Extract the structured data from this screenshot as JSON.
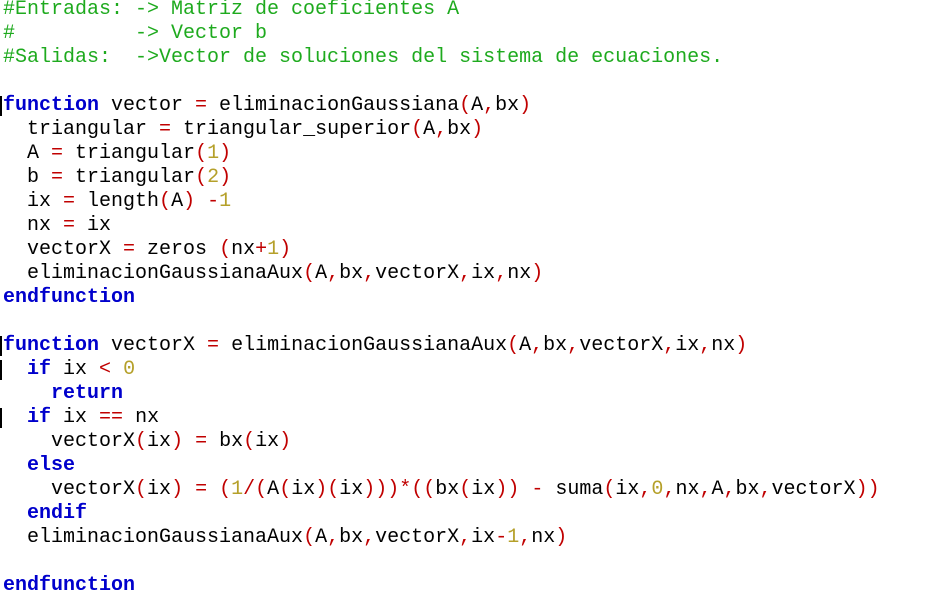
{
  "editor": {
    "language": "Octave",
    "colors": {
      "comment": "#1eaa1e",
      "keyword": "#0000cc",
      "identifier": "#000000",
      "number": "#b5a02a",
      "operator": "#c00000"
    },
    "lines": [
      [
        {
          "t": "comment",
          "s": "#Entradas: -> Matriz de coeficientes A"
        }
      ],
      [
        {
          "t": "comment",
          "s": "#          -> Vector b"
        }
      ],
      [
        {
          "t": "comment",
          "s": "#Salidas:  ->Vector de soluciones del sistema de ecuaciones."
        }
      ],
      [],
      [
        {
          "t": "kw",
          "s": "function"
        },
        {
          "t": "id",
          "s": " vector "
        },
        {
          "t": "op",
          "s": "="
        },
        {
          "t": "id",
          "s": " eliminacionGaussiana"
        },
        {
          "t": "op",
          "s": "("
        },
        {
          "t": "id",
          "s": "A"
        },
        {
          "t": "op",
          "s": ","
        },
        {
          "t": "id",
          "s": "bx"
        },
        {
          "t": "op",
          "s": ")"
        }
      ],
      [
        {
          "t": "id",
          "s": "  triangular "
        },
        {
          "t": "op",
          "s": "="
        },
        {
          "t": "id",
          "s": " triangular_superior"
        },
        {
          "t": "op",
          "s": "("
        },
        {
          "t": "id",
          "s": "A"
        },
        {
          "t": "op",
          "s": ","
        },
        {
          "t": "id",
          "s": "bx"
        },
        {
          "t": "op",
          "s": ")"
        }
      ],
      [
        {
          "t": "id",
          "s": "  A "
        },
        {
          "t": "op",
          "s": "="
        },
        {
          "t": "id",
          "s": " triangular"
        },
        {
          "t": "op",
          "s": "("
        },
        {
          "t": "num",
          "s": "1"
        },
        {
          "t": "op",
          "s": ")"
        }
      ],
      [
        {
          "t": "id",
          "s": "  b "
        },
        {
          "t": "op",
          "s": "="
        },
        {
          "t": "id",
          "s": " triangular"
        },
        {
          "t": "op",
          "s": "("
        },
        {
          "t": "num",
          "s": "2"
        },
        {
          "t": "op",
          "s": ")"
        }
      ],
      [
        {
          "t": "id",
          "s": "  ix "
        },
        {
          "t": "op",
          "s": "="
        },
        {
          "t": "id",
          "s": " length"
        },
        {
          "t": "op",
          "s": "("
        },
        {
          "t": "id",
          "s": "A"
        },
        {
          "t": "op",
          "s": ")"
        },
        {
          "t": "id",
          "s": " "
        },
        {
          "t": "op",
          "s": "-"
        },
        {
          "t": "num",
          "s": "1"
        }
      ],
      [
        {
          "t": "id",
          "s": "  nx "
        },
        {
          "t": "op",
          "s": "="
        },
        {
          "t": "id",
          "s": " ix"
        }
      ],
      [
        {
          "t": "id",
          "s": "  vectorX "
        },
        {
          "t": "op",
          "s": "="
        },
        {
          "t": "id",
          "s": " zeros "
        },
        {
          "t": "op",
          "s": "("
        },
        {
          "t": "id",
          "s": "nx"
        },
        {
          "t": "op",
          "s": "+"
        },
        {
          "t": "num",
          "s": "1"
        },
        {
          "t": "op",
          "s": ")"
        }
      ],
      [
        {
          "t": "id",
          "s": "  eliminacionGaussianaAux"
        },
        {
          "t": "op",
          "s": "("
        },
        {
          "t": "id",
          "s": "A"
        },
        {
          "t": "op",
          "s": ","
        },
        {
          "t": "id",
          "s": "bx"
        },
        {
          "t": "op",
          "s": ","
        },
        {
          "t": "id",
          "s": "vectorX"
        },
        {
          "t": "op",
          "s": ","
        },
        {
          "t": "id",
          "s": "ix"
        },
        {
          "t": "op",
          "s": ","
        },
        {
          "t": "id",
          "s": "nx"
        },
        {
          "t": "op",
          "s": ")"
        }
      ],
      [
        {
          "t": "kw",
          "s": "endfunction"
        }
      ],
      [],
      [
        {
          "t": "kw",
          "s": "function"
        },
        {
          "t": "id",
          "s": " vectorX "
        },
        {
          "t": "op",
          "s": "="
        },
        {
          "t": "id",
          "s": " eliminacionGaussianaAux"
        },
        {
          "t": "op",
          "s": "("
        },
        {
          "t": "id",
          "s": "A"
        },
        {
          "t": "op",
          "s": ","
        },
        {
          "t": "id",
          "s": "bx"
        },
        {
          "t": "op",
          "s": ","
        },
        {
          "t": "id",
          "s": "vectorX"
        },
        {
          "t": "op",
          "s": ","
        },
        {
          "t": "id",
          "s": "ix"
        },
        {
          "t": "op",
          "s": ","
        },
        {
          "t": "id",
          "s": "nx"
        },
        {
          "t": "op",
          "s": ")"
        }
      ],
      [
        {
          "t": "id",
          "s": "  "
        },
        {
          "t": "kw",
          "s": "if"
        },
        {
          "t": "id",
          "s": " ix "
        },
        {
          "t": "op",
          "s": "<"
        },
        {
          "t": "id",
          "s": " "
        },
        {
          "t": "num",
          "s": "0"
        }
      ],
      [
        {
          "t": "id",
          "s": "    "
        },
        {
          "t": "kw",
          "s": "return"
        }
      ],
      [
        {
          "t": "id",
          "s": "  "
        },
        {
          "t": "kw",
          "s": "if"
        },
        {
          "t": "id",
          "s": " ix "
        },
        {
          "t": "op",
          "s": "=="
        },
        {
          "t": "id",
          "s": " nx"
        }
      ],
      [
        {
          "t": "id",
          "s": "    vectorX"
        },
        {
          "t": "op",
          "s": "("
        },
        {
          "t": "id",
          "s": "ix"
        },
        {
          "t": "op",
          "s": ")"
        },
        {
          "t": "id",
          "s": " "
        },
        {
          "t": "op",
          "s": "="
        },
        {
          "t": "id",
          "s": " bx"
        },
        {
          "t": "op",
          "s": "("
        },
        {
          "t": "id",
          "s": "ix"
        },
        {
          "t": "op",
          "s": ")"
        }
      ],
      [
        {
          "t": "id",
          "s": "  "
        },
        {
          "t": "kw",
          "s": "else"
        }
      ],
      [
        {
          "t": "id",
          "s": "    vectorX"
        },
        {
          "t": "op",
          "s": "("
        },
        {
          "t": "id",
          "s": "ix"
        },
        {
          "t": "op",
          "s": ")"
        },
        {
          "t": "id",
          "s": " "
        },
        {
          "t": "op",
          "s": "="
        },
        {
          "t": "id",
          "s": " "
        },
        {
          "t": "op",
          "s": "("
        },
        {
          "t": "num",
          "s": "1"
        },
        {
          "t": "op",
          "s": "/("
        },
        {
          "t": "id",
          "s": "A"
        },
        {
          "t": "op",
          "s": "("
        },
        {
          "t": "id",
          "s": "ix"
        },
        {
          "t": "op",
          "s": ")("
        },
        {
          "t": "id",
          "s": "ix"
        },
        {
          "t": "op",
          "s": ")))*(("
        },
        {
          "t": "id",
          "s": "bx"
        },
        {
          "t": "op",
          "s": "("
        },
        {
          "t": "id",
          "s": "ix"
        },
        {
          "t": "op",
          "s": "))"
        },
        {
          "t": "id",
          "s": " "
        },
        {
          "t": "op",
          "s": "-"
        },
        {
          "t": "id",
          "s": " suma"
        },
        {
          "t": "op",
          "s": "("
        },
        {
          "t": "id",
          "s": "ix"
        },
        {
          "t": "op",
          "s": ","
        },
        {
          "t": "num",
          "s": "0"
        },
        {
          "t": "op",
          "s": ","
        },
        {
          "t": "id",
          "s": "nx"
        },
        {
          "t": "op",
          "s": ","
        },
        {
          "t": "id",
          "s": "A"
        },
        {
          "t": "op",
          "s": ","
        },
        {
          "t": "id",
          "s": "bx"
        },
        {
          "t": "op",
          "s": ","
        },
        {
          "t": "id",
          "s": "vectorX"
        },
        {
          "t": "op",
          "s": "))"
        }
      ],
      [
        {
          "t": "id",
          "s": "  "
        },
        {
          "t": "kw",
          "s": "endif"
        }
      ],
      [
        {
          "t": "id",
          "s": "  eliminacionGaussianaAux"
        },
        {
          "t": "op",
          "s": "("
        },
        {
          "t": "id",
          "s": "A"
        },
        {
          "t": "op",
          "s": ","
        },
        {
          "t": "id",
          "s": "bx"
        },
        {
          "t": "op",
          "s": ","
        },
        {
          "t": "id",
          "s": "vectorX"
        },
        {
          "t": "op",
          "s": ","
        },
        {
          "t": "id",
          "s": "ix"
        },
        {
          "t": "op",
          "s": "-"
        },
        {
          "t": "num",
          "s": "1"
        },
        {
          "t": "op",
          "s": ","
        },
        {
          "t": "id",
          "s": "nx"
        },
        {
          "t": "op",
          "s": ")"
        }
      ],
      [],
      [
        {
          "t": "kw",
          "s": "endfunction"
        }
      ]
    ]
  }
}
